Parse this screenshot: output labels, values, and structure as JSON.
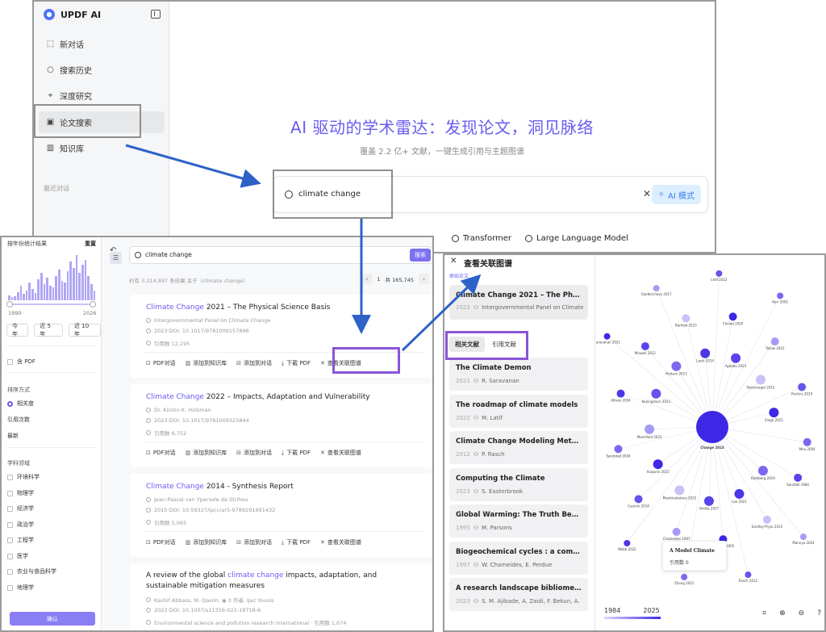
{
  "panel_a": {
    "app_title": "UPDF AI",
    "sidebar": [
      {
        "label": "新对话",
        "icon": "chat-icon"
      },
      {
        "label": "搜索历史",
        "icon": "search-icon"
      },
      {
        "label": "深度研究",
        "icon": "telescope-icon"
      },
      {
        "label": "论文搜索",
        "icon": "paper-search-icon"
      },
      {
        "label": "知识库",
        "icon": "book-icon"
      }
    ],
    "recent_label": "最近对话",
    "hero_title": "AI 驱动的学术雷达：发现论文，洞见脉络",
    "hero_subtitle": "覆盖 2.2 亿+ 文献，一键生成引用与主题图谱",
    "search_value": "climate change",
    "ai_mode_label": "AI 模式",
    "suggestions": [
      "Transformer",
      "Large Language Model"
    ]
  },
  "panel_b": {
    "filter_header": "按年份统计结果",
    "reset": "重置",
    "year_start": "1990",
    "year_end": "2026",
    "year_buttons": [
      "今年",
      "近 5 年",
      "近 10 年"
    ],
    "pdf_label": "含 PDF",
    "sort_title": "排序方式",
    "sort_options": [
      "相关度",
      "引用次数",
      "最新"
    ],
    "field_title": "学科领域",
    "fields": [
      "环境科学",
      "物理学",
      "经济学",
      "政治学",
      "工程学",
      "医学",
      "农业与食品科学",
      "地理学"
    ],
    "confirm": "确认",
    "search_value": "climate change",
    "search_button": "搜索",
    "result_summary": "约有 3,314,897 条结果 关于（climate change）",
    "page_current": "1",
    "page_total": "共 165,745",
    "results": [
      {
        "title_hl": "Climate Change",
        "title_rest": " 2021 – The Physical Science Basis",
        "author": "Intergovernmental Panel on Climate Change",
        "doi": "2023·DOI: 10.1017/9781009157896",
        "cites": "引用数 12,195"
      },
      {
        "title_hl": "Climate Change",
        "title_rest": " 2022 – Impacts, Adaptation and Vulnerability",
        "author": "Dr. Kirstin K. Holsman",
        "doi": "2023·DOI: 10.1017/9781009325844",
        "cites": "引用数 6,752"
      },
      {
        "title_hl": "Climate Change",
        "title_rest": " 2014 - Synthesis Report",
        "author": "Jean-Pascal van Ypersele de Strihou",
        "doi": "2015·DOI: 10.59327/ipcc/ar5-9789291691432",
        "cites": "引用数 5,065"
      }
    ],
    "result4": {
      "title_a": "A review of the global ",
      "title_hl": "climate change",
      "title_b": " impacts, adaptation, and sustainable mitigation measures",
      "authors": "Kashif Abbass, M. Qasim, ◉ 3 作者, Ijaz Younis",
      "doi": "2022·DOI: 10.1007/s11356-022-19718-6",
      "venue": "Environmental science and pollution research international · 引用数 1,674"
    },
    "actions": [
      "PDF对话",
      "添加到知识库",
      "添加到对话",
      "下载 PDF",
      "查看关联图谱"
    ]
  },
  "panel_c": {
    "title": "查看关联图谱",
    "origin_label": "原始论文",
    "origin": {
      "title": "Climate Change 2021 – The Physical Science Basis",
      "year": "2023",
      "author": "Intergovernmental Panel on Climate Change"
    },
    "tabs": [
      "相关文献",
      "引用文献"
    ],
    "related": [
      {
        "title": "The Climate Demon",
        "year": "2021",
        "author": "R. Saravanan"
      },
      {
        "title": "The roadmap of climate models",
        "year": "2022",
        "author": "M. Latif"
      },
      {
        "title": "Climate Change Modeling Methodology",
        "year": "2012",
        "author": "P. Rasch"
      },
      {
        "title": "Computing the Climate",
        "year": "2023",
        "author": "S. Easterbrook"
      },
      {
        "title": "Global Warming: The Truth Behind the Myth",
        "year": "1995",
        "author": "M. Parsons"
      },
      {
        "title": "Biogeochemical cycles : a computer-interactive study",
        "year": "1997",
        "author": "W. Chameides, E. Perdue"
      },
      {
        "title": "A research landscape bibliometric analysis",
        "year": "2023",
        "author": "S. M. Ajibade, A. Zaidi, F. Bekun, A."
      }
    ],
    "graph": {
      "center_label": "Change 2023",
      "node_labels": [
        "Martin 2010",
        "Sandahl 1984",
        "Rothberg 2019",
        "Mannya 2024",
        "Eardley-Pryor 2015",
        "Lee 2021",
        "Rasch 2012",
        "Dehtrev 2005",
        "Omilla 2017",
        "Zhang 2021",
        "Chameides 1997",
        "Meetmadatova 2025",
        "Webb 2022",
        "Castrini 2010",
        "Xiaoprin 2015",
        "Jones 2021",
        "Sandstad 2024",
        "Mansfield 2023",
        "Persons 1995",
        "Allison 2024",
        "Koningstorn 2023",
        "Saravanan 2021",
        "Miswell 2022",
        "Hodson 2013",
        "Gladbrichova 2017",
        "Bartlow 2023",
        "Lacik 2014",
        "Letif 2022",
        "Chelod 2020",
        "Aybado 2023",
        "Kerr 2002",
        "Tallow 2022",
        "Dooreneget 2015",
        "Poptayev 2025",
        "Perkins 2019",
        "Singh 2025",
        "Ruthe 2020",
        "Mou 2004"
      ],
      "tooltip_title": "A Model Climate",
      "tooltip_cites": "引用数 0",
      "year_min": "1984",
      "year_max": "2025"
    }
  },
  "colors": {
    "accent": "#6a5cf0",
    "highlight_purple": "#8a55d6",
    "arrow_blue": "#2d62c8"
  }
}
